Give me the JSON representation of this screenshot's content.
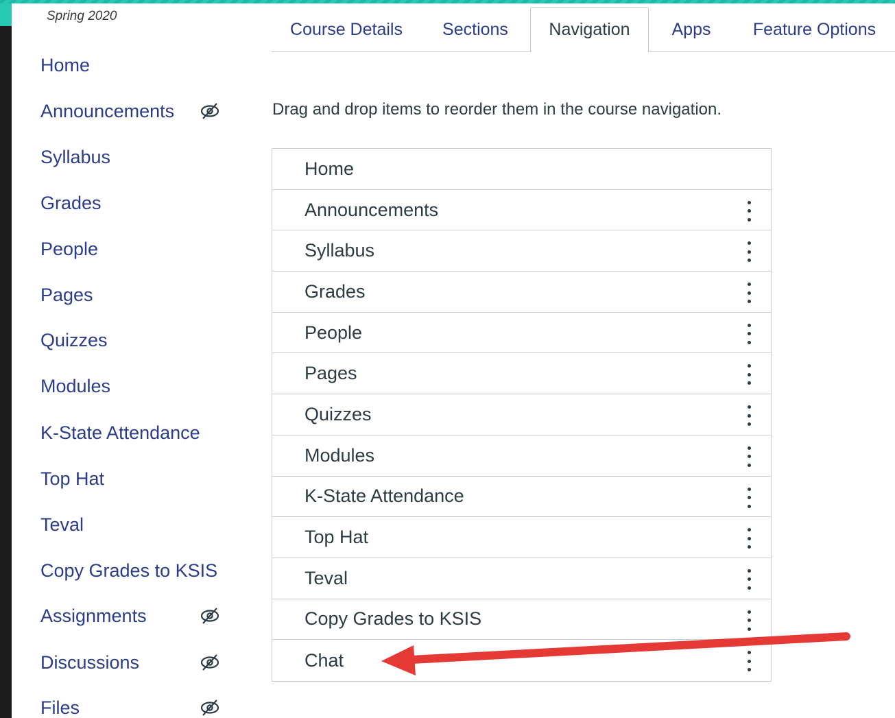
{
  "term": "Spring 2020",
  "sidebar": {
    "items": [
      {
        "label": "Home",
        "hidden": false
      },
      {
        "label": "Announcements",
        "hidden": true
      },
      {
        "label": "Syllabus",
        "hidden": false
      },
      {
        "label": "Grades",
        "hidden": false
      },
      {
        "label": "People",
        "hidden": false
      },
      {
        "label": "Pages",
        "hidden": false
      },
      {
        "label": "Quizzes",
        "hidden": false
      },
      {
        "label": "Modules",
        "hidden": false
      },
      {
        "label": "K-State Attendance",
        "hidden": false
      },
      {
        "label": "Top Hat",
        "hidden": false
      },
      {
        "label": "Teval",
        "hidden": false
      },
      {
        "label": "Copy Grades to KSIS",
        "hidden": false
      },
      {
        "label": "Assignments",
        "hidden": true
      },
      {
        "label": "Discussions",
        "hidden": true
      },
      {
        "label": "Files",
        "hidden": true
      }
    ]
  },
  "tabs": [
    {
      "label": "Course Details",
      "active": false
    },
    {
      "label": "Sections",
      "active": false
    },
    {
      "label": "Navigation",
      "active": true
    },
    {
      "label": "Apps",
      "active": false
    },
    {
      "label": "Feature Options",
      "active": false
    }
  ],
  "instructions": "Drag and drop items to reorder them in the course navigation.",
  "nav_items": [
    {
      "label": "Home",
      "menu": false
    },
    {
      "label": "Announcements",
      "menu": true
    },
    {
      "label": "Syllabus",
      "menu": true
    },
    {
      "label": "Grades",
      "menu": true
    },
    {
      "label": "People",
      "menu": true
    },
    {
      "label": "Pages",
      "menu": true
    },
    {
      "label": "Quizzes",
      "menu": true
    },
    {
      "label": "Modules",
      "menu": true
    },
    {
      "label": "K-State Attendance",
      "menu": true
    },
    {
      "label": "Top Hat",
      "menu": true
    },
    {
      "label": "Teval",
      "menu": true
    },
    {
      "label": "Copy Grades to KSIS",
      "menu": true
    },
    {
      "label": "Chat",
      "menu": true
    }
  ],
  "hidden_icon": "eye-slash-icon",
  "menu_icon": "kebab-menu-icon",
  "annotation_icon": "red-arrow-icon",
  "colors": {
    "link": "#2a3c8a",
    "text": "#2d3b45",
    "border": "#c7cdd1",
    "arrow": "#e53935",
    "accent_stripe": "#27c9b5"
  }
}
